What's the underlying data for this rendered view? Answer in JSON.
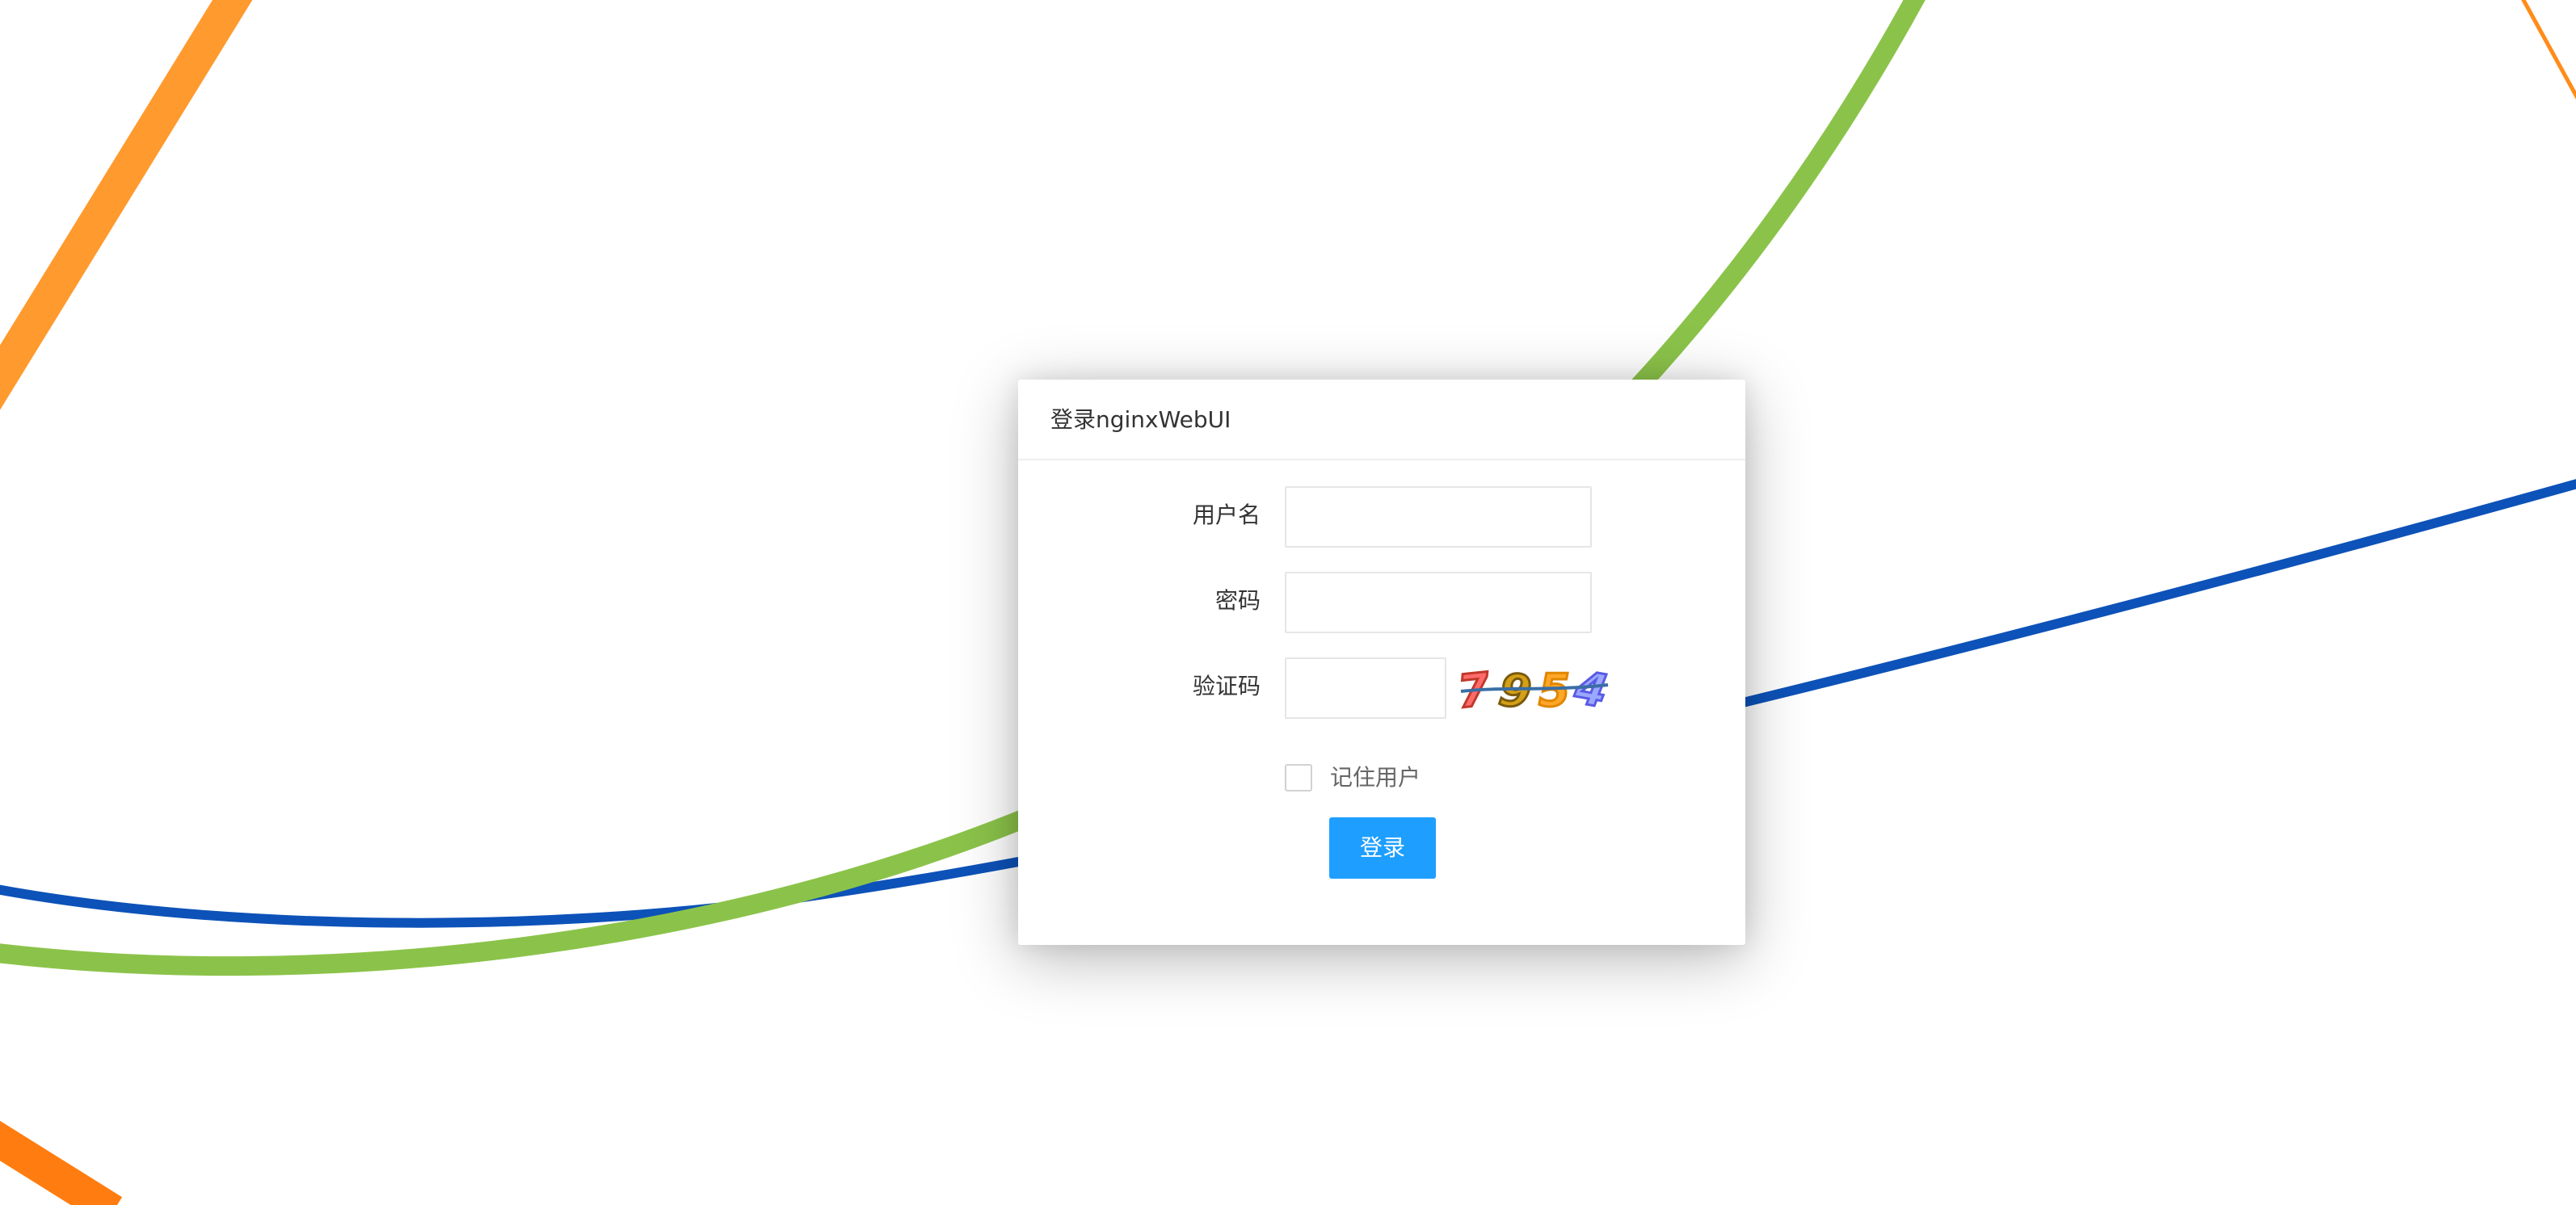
{
  "colors": {
    "primary_button": "#1e9fff",
    "line_orange": "#ff8c1a",
    "line_green": "#8bc34a",
    "line_blue": "#0d52b8"
  },
  "dialog": {
    "title": "登录nginxWebUI"
  },
  "form": {
    "username_label": "用户名",
    "username_value": "",
    "password_label": "密码",
    "password_value": "",
    "captcha_label": "验证码",
    "captcha_value": "",
    "captcha_text": "7954",
    "remember_label": "记住用户",
    "remember_checked": false,
    "login_button": "登录"
  }
}
